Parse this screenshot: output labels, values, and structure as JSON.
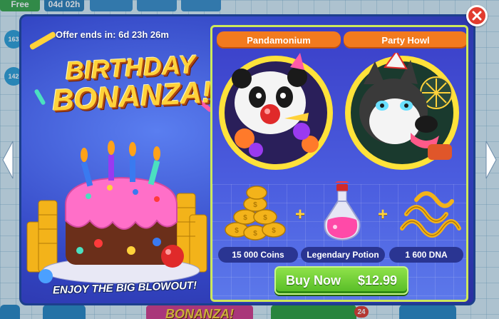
{
  "background": {
    "free_label": "Free",
    "timer_label": "04d 02h",
    "side_counts": [
      "163",
      "142"
    ],
    "bottom_badge": "24",
    "bottom_logo_text": "BONANZA!"
  },
  "offer": {
    "ends_label": "Offer ends in: 6d 23h 26m",
    "title_line1": "BIRTHDAY",
    "title_line2": "BONANZA!",
    "tagline": "ENJOY THE BIG BLOWOUT!"
  },
  "skins": [
    {
      "name": "Pandamonium",
      "icon": "panda-skin-icon"
    },
    {
      "name": "Party Howl",
      "icon": "husky-skin-icon"
    }
  ],
  "rewards": [
    {
      "label": "15 000 Coins",
      "icon": "coins-pile-icon"
    },
    {
      "label": "Legendary Potion",
      "icon": "potion-icon"
    },
    {
      "label": "1 600 DNA",
      "icon": "dna-pile-icon"
    }
  ],
  "buy": {
    "label": "Buy Now",
    "price": "$12.99"
  },
  "colors": {
    "tab_orange": "#f27a1e",
    "buy_green": "#55bb26",
    "close_red": "#e23b2e",
    "title_gold": "#ffd23a",
    "panel_blue": "#3a3fc8"
  }
}
